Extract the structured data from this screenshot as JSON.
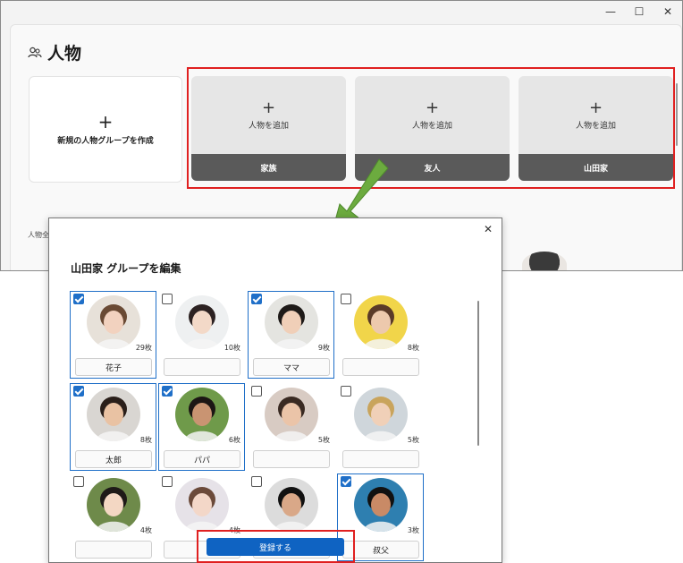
{
  "window": {
    "title": "人物",
    "controls": {
      "minimize": "—",
      "maximize": "☐",
      "close": "✕"
    }
  },
  "new_group": {
    "plus": "+",
    "label": "新規の人物グループを作成"
  },
  "group_cards": [
    {
      "plus": "+",
      "add_label": "人物を追加",
      "name": "家族"
    },
    {
      "plus": "+",
      "add_label": "人物を追加",
      "name": "友人"
    },
    {
      "plus": "+",
      "add_label": "人物を追加",
      "name": "山田家"
    }
  ],
  "background_subtitle": "人物全",
  "dialog": {
    "title": "山田家 グループを編集",
    "close": "✕",
    "people": [
      {
        "count": "29枚",
        "name": "花子",
        "selected": true,
        "skin": "#f2d2bf",
        "hair": "#6a4a34",
        "bg": "#e7e1d9"
      },
      {
        "count": "10枚",
        "name": "",
        "selected": false,
        "skin": "#f3d9c8",
        "hair": "#2c2222",
        "bg": "#eef0f1"
      },
      {
        "count": "9枚",
        "name": "ママ",
        "selected": true,
        "skin": "#f0cfb8",
        "hair": "#1e1a18",
        "bg": "#e4e4e0"
      },
      {
        "count": "8枚",
        "name": "",
        "selected": false,
        "skin": "#edc9ad",
        "hair": "#5a3a28",
        "bg": "#f1d54a"
      },
      {
        "count": "8枚",
        "name": "太郎",
        "selected": true,
        "skin": "#e9c2a3",
        "hair": "#2a1f1a",
        "bg": "#d9d6d2"
      },
      {
        "count": "6枚",
        "name": "パパ",
        "selected": true,
        "skin": "#c99472",
        "hair": "#1c1614",
        "bg": "#6f9a4a"
      },
      {
        "count": "5枚",
        "name": "",
        "selected": false,
        "skin": "#ebc4a8",
        "hair": "#3a2a22",
        "bg": "#d8cbc3"
      },
      {
        "count": "5枚",
        "name": "",
        "selected": false,
        "skin": "#f0d0b8",
        "hair": "#c9a45c",
        "bg": "#cfd6db"
      },
      {
        "count": "4枚",
        "name": "",
        "selected": false,
        "skin": "#f3d7c3",
        "hair": "#1e1a18",
        "bg": "#6e8a4a"
      },
      {
        "count": "4枚",
        "name": "",
        "selected": false,
        "skin": "#f3d7c8",
        "hair": "#6b4a3a",
        "bg": "#e6e2e8"
      },
      {
        "count": "",
        "name": "",
        "selected": false,
        "skin": "#d9a888",
        "hair": "#111111",
        "bg": "#dcdcdc"
      },
      {
        "count": "3枚",
        "name": "叔父",
        "selected": true,
        "skin": "#c98a66",
        "hair": "#111111",
        "bg": "#2e7fb0"
      }
    ],
    "register_button": "登録する"
  }
}
